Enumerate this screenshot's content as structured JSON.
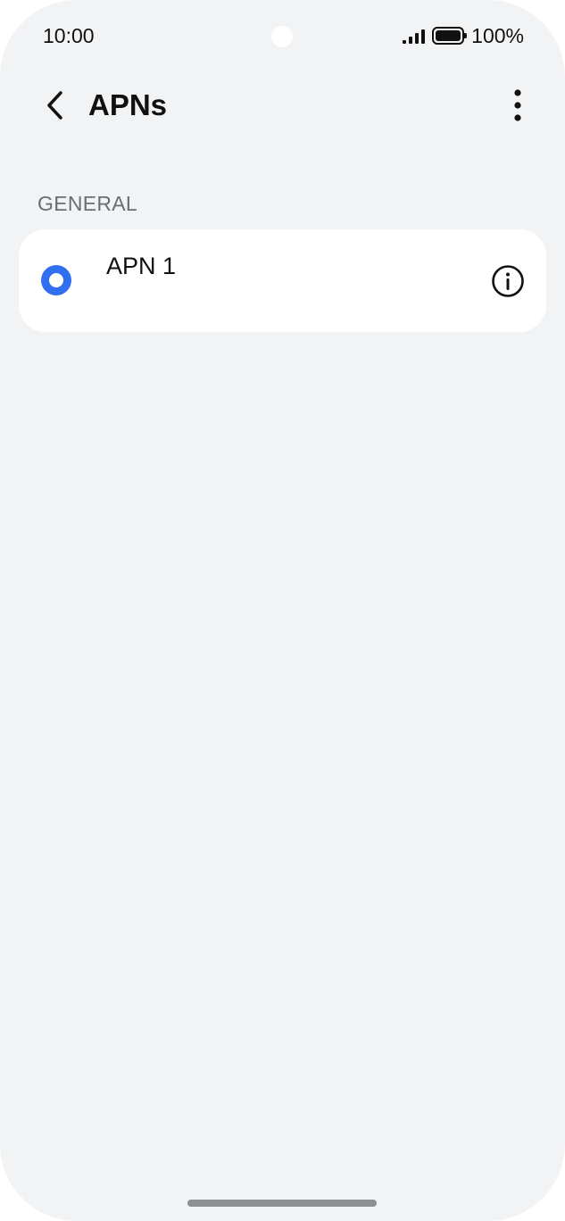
{
  "status_bar": {
    "time": "10:00",
    "battery": "100%",
    "icons": [
      "signal-icon",
      "battery-icon"
    ]
  },
  "app_bar": {
    "title": "APNs",
    "back_icon": "chevron-left-icon",
    "more_icon": "more-vert-icon"
  },
  "section": {
    "header": "GENERAL"
  },
  "apns": [
    {
      "name": "APN 1",
      "selected": true,
      "info_icon": "info-icon"
    }
  ],
  "colors": {
    "accent": "#2f6ff0",
    "background": "#f2f3f5",
    "card": "#ffffff",
    "secondary_text": "#6b6d72"
  }
}
